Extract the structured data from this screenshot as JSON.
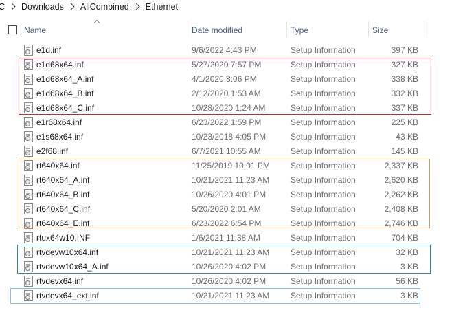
{
  "breadcrumb": {
    "items": [
      "C",
      "Downloads",
      "AllCombined",
      "Ethernet"
    ]
  },
  "header": {
    "name": "Name",
    "date_modified": "Date modified",
    "type": "Type",
    "size": "Size"
  },
  "files": [
    {
      "name": "e1d.inf",
      "date": "9/6/2022 4:43 PM",
      "type": "Setup Information",
      "size": "397 KB"
    },
    {
      "name": "e1d68x64.inf",
      "date": "5/27/2020 7:57 PM",
      "type": "Setup Information",
      "size": "327 KB"
    },
    {
      "name": "e1d68x64_A.inf",
      "date": "4/1/2020 8:06 PM",
      "type": "Setup Information",
      "size": "338 KB"
    },
    {
      "name": "e1d68x64_B.inf",
      "date": "2/12/2020 1:53 AM",
      "type": "Setup Information",
      "size": "332 KB"
    },
    {
      "name": "e1d68x64_C.inf",
      "date": "10/28/2020 1:24 AM",
      "type": "Setup Information",
      "size": "337 KB"
    },
    {
      "name": "e1r68x64.inf",
      "date": "6/23/2022 1:59 PM",
      "type": "Setup Information",
      "size": "225 KB"
    },
    {
      "name": "e1s68x64.inf",
      "date": "10/23/2018 4:05 PM",
      "type": "Setup Information",
      "size": "43 KB"
    },
    {
      "name": "e2f68.inf",
      "date": "6/7/2021 10:55 AM",
      "type": "Setup Information",
      "size": "145 KB"
    },
    {
      "name": "rt640x64.inf",
      "date": "11/25/2019 10:01 PM",
      "type": "Setup Information",
      "size": "2,337 KB"
    },
    {
      "name": "rt640x64_A.inf",
      "date": "10/21/2021 11:23 AM",
      "type": "Setup Information",
      "size": "2,620 KB"
    },
    {
      "name": "rt640x64_B.inf",
      "date": "10/26/2020 4:01 PM",
      "type": "Setup Information",
      "size": "2,262 KB"
    },
    {
      "name": "rt640x64_C.inf",
      "date": "5/20/2020 2:01 AM",
      "type": "Setup Information",
      "size": "2,408 KB"
    },
    {
      "name": "rt640x64_E.inf",
      "date": "6/23/2022 6:54 PM",
      "type": "Setup Information",
      "size": "2,746 KB"
    },
    {
      "name": "rtux64w10.INF",
      "date": "1/6/2021 11:38 AM",
      "type": "Setup Information",
      "size": "704 KB"
    },
    {
      "name": "rtvdevw10x64.inf",
      "date": "10/21/2021 11:23 AM",
      "type": "Setup Information",
      "size": "32 KB"
    },
    {
      "name": "rtvdevw10x64_A.inf",
      "date": "10/26/2020 4:02 PM",
      "type": "Setup Information",
      "size": "3 KB"
    },
    {
      "name": "rtvdevx64.inf",
      "date": "10/26/2020 4:02 PM",
      "type": "Setup Information",
      "size": "56 KB"
    },
    {
      "name": "rtvdevx64_ext.inf",
      "date": "10/21/2021 11:23 AM",
      "type": "Setup Information",
      "size": "3 KB"
    }
  ],
  "highlight_colors": {
    "red": "#c02a33",
    "orange": "#e09b52",
    "teal": "#2a8aa3",
    "light_blue": "#7ec7e8"
  },
  "icons": {
    "file": "setup-information-file-icon",
    "separator": "chevron-right-icon",
    "sort": "sort-ascending-icon"
  }
}
